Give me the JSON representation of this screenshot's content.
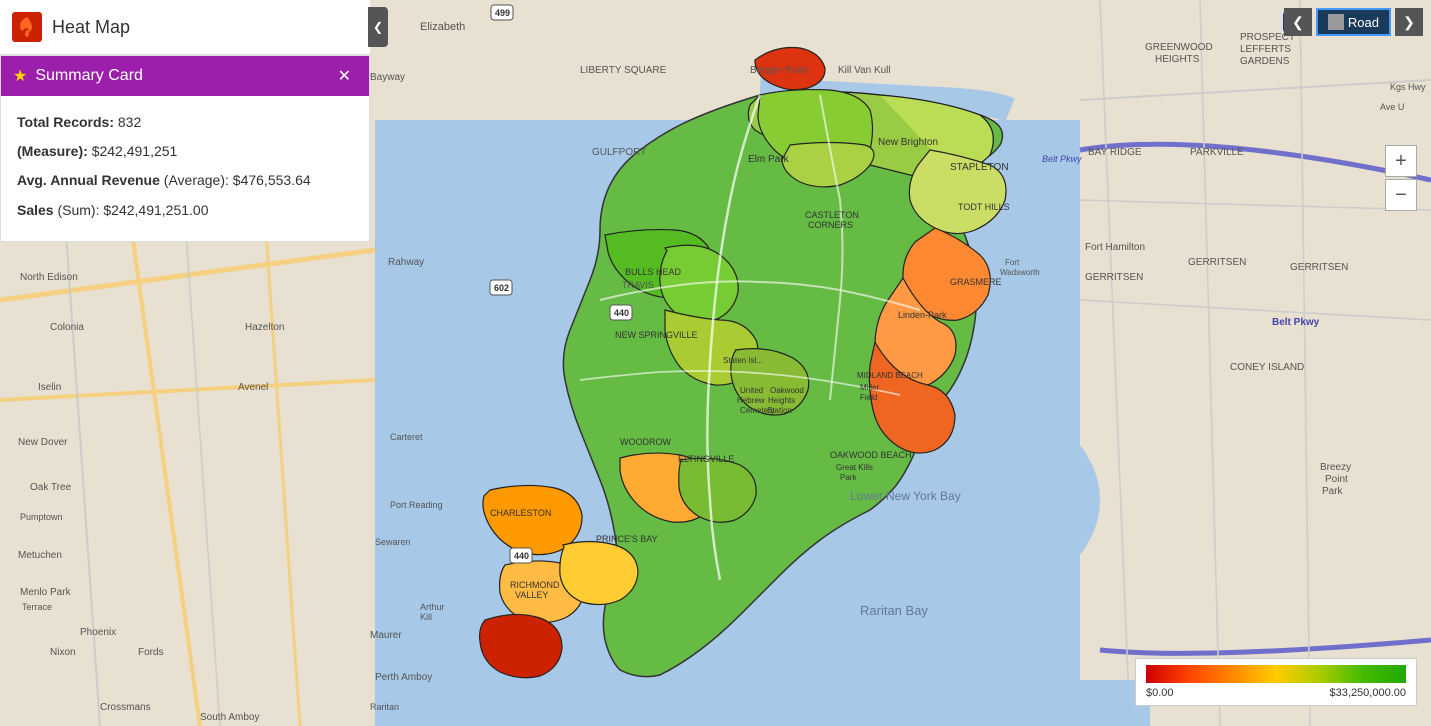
{
  "header": {
    "title": "Heat Map",
    "icon_label": "flame-icon"
  },
  "summary_card": {
    "title": "Summary Card",
    "total_records_label": "Total Records:",
    "total_records_value": "832",
    "measure_label": "(Measure):",
    "measure_value": "$242,491,251",
    "avg_annual_revenue_label": "Avg. Annual Revenue",
    "avg_annual_revenue_sub": "(Average):",
    "avg_annual_revenue_value": "$476,553.64",
    "sales_label": "Sales",
    "sales_sub": "(Sum):",
    "sales_value": "$242,491,251.00"
  },
  "controls": {
    "prev_label": "❮",
    "next_label": "❯",
    "road_label": "Road",
    "zoom_in_label": "+",
    "zoom_out_label": "−"
  },
  "legend": {
    "min_label": "$0.00",
    "max_label": "$33,250,000.00"
  },
  "colors": {
    "header_purple": "#9b1faa",
    "header_red": "#cc2200",
    "road_btn_bg": "#1a3a5c",
    "road_btn_border": "#4499ff"
  }
}
